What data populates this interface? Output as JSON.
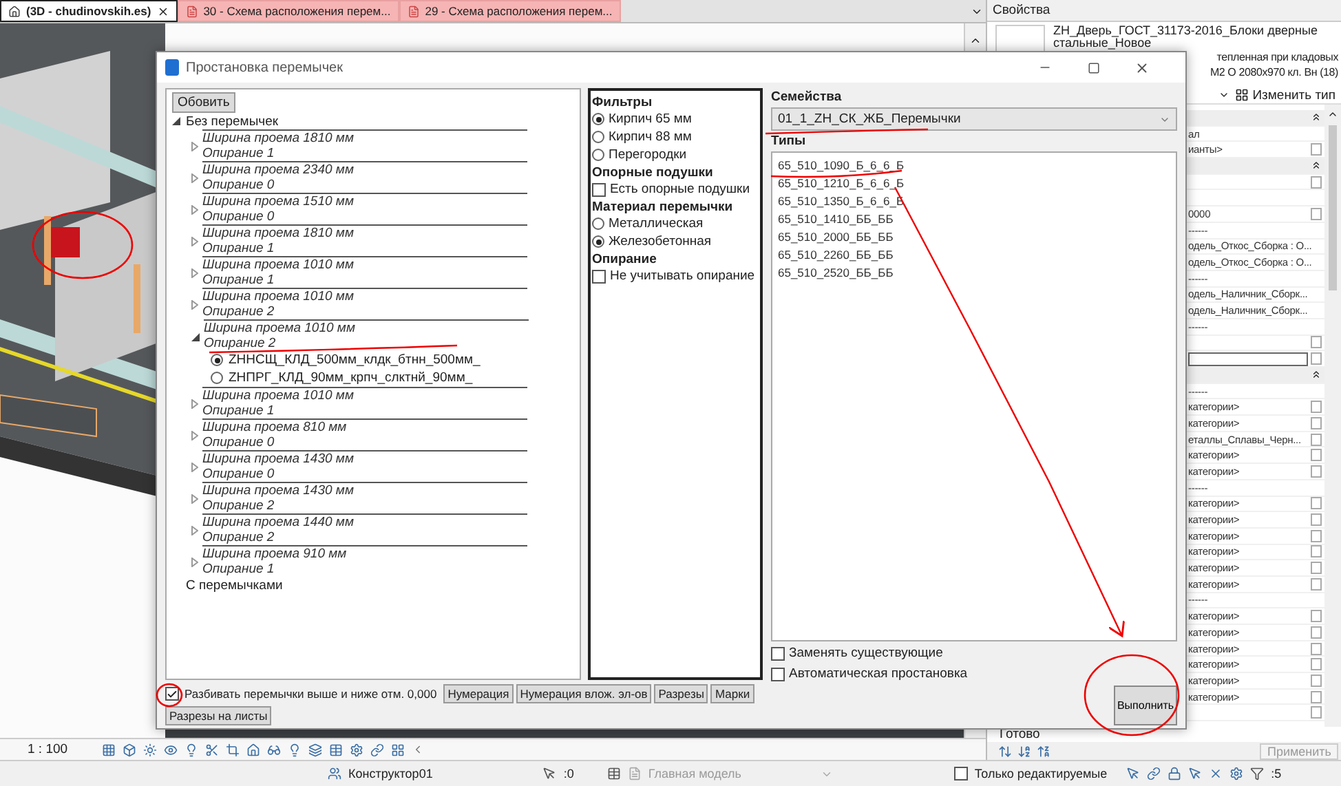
{
  "tabs": [
    {
      "label": "(3D - chudinovskih.es)",
      "selected": true,
      "kind": "model"
    },
    {
      "label": "30 - Схема расположения перем...",
      "selected": false,
      "kind": "sheet"
    },
    {
      "label": "29 - Схема расположения перем...",
      "selected": false,
      "kind": "sheet"
    }
  ],
  "dialog": {
    "title": "Простановка перемычек",
    "refresh_button": "Обовить",
    "tree": [
      {
        "label": "Без перемычек",
        "expanded": true,
        "children": [
          {
            "width": "Ширина проема 1810 мм",
            "support": "Опирание 1",
            "expanded": false
          },
          {
            "width": "Ширина проема 2340 мм",
            "support": "Опирание 0",
            "expanded": false
          },
          {
            "width": "Ширина проема 1510 мм",
            "support": "Опирание 0",
            "expanded": false
          },
          {
            "width": "Ширина проема 1810 мм",
            "support": "Опирание 1",
            "expanded": false
          },
          {
            "width": "Ширина проема 1010 мм",
            "support": "Опирание 1",
            "expanded": false
          },
          {
            "width": "Ширина проема 1010 мм",
            "support": "Опирание 2",
            "expanded": false
          },
          {
            "width": "Ширина проема 1010 мм",
            "support": "Опирание 2",
            "expanded": true,
            "children": [
              {
                "label": "ZHНСЩ_КЛД_500мм_клдк_бтнн_500мм_",
                "selected": true
              },
              {
                "label": "ZHПРГ_КЛД_90мм_крпч_слктнй_90мм_",
                "selected": false
              }
            ]
          },
          {
            "width": "Ширина проема 1010 мм",
            "support": "Опирание 1",
            "expanded": false
          },
          {
            "width": "Ширина проема 810 мм",
            "support": "Опирание 0",
            "expanded": false
          },
          {
            "width": "Ширина проема 1430 мм",
            "support": "Опирание 0",
            "expanded": false
          },
          {
            "width": "Ширина проема 1430 мм",
            "support": "Опирание 2",
            "expanded": false
          },
          {
            "width": "Ширина проема 1440 мм",
            "support": "Опирание 2",
            "expanded": false
          },
          {
            "width": "Ширина проема 910 мм",
            "support": "Опирание 1",
            "expanded": false
          }
        ]
      },
      {
        "label": "С перемычками"
      }
    ],
    "filters": [
      {
        "title": "Фильтры",
        "options": [
          {
            "kind": "radio",
            "label": "Кирпич 65 мм",
            "selected": true
          },
          {
            "kind": "radio",
            "label": "Кирпич 88 мм",
            "selected": false
          },
          {
            "kind": "radio",
            "label": "Перегородки",
            "selected": false
          }
        ]
      },
      {
        "title": "Опорные подушки",
        "options": [
          {
            "kind": "checkbox",
            "label": "Есть опорные подушки",
            "checked": false
          }
        ]
      },
      {
        "title": "Материал перемычки",
        "options": [
          {
            "kind": "radio",
            "label": "Металлическая",
            "selected": false
          },
          {
            "kind": "radio",
            "label": "Железобетонная",
            "selected": true
          }
        ]
      },
      {
        "title": "Опирание",
        "options": [
          {
            "kind": "checkbox",
            "label": "Не учитывать опирание",
            "checked": false
          }
        ]
      }
    ],
    "families_label": "Семейства",
    "family": "01_1_ZH_СК_ЖБ_Перемычки",
    "types_label": "Типы",
    "types": [
      "65_510_1090_Б_6_6_Б",
      "65_510_1210_Б_6_6_Б",
      "65_510_1350_Б_6_6_Б",
      "65_510_1410_ББ_ББ",
      "65_510_2000_ББ_ББ",
      "65_510_2260_ББ_ББ",
      "65_510_2520_ББ_ББ"
    ],
    "options": [
      {
        "label": "Заменять существующие",
        "checked": false
      },
      {
        "label": "Автоматическая простановка",
        "checked": false
      }
    ],
    "split_option": {
      "label": "Разбивать перемычки выше и ниже отм. 0,000",
      "checked": true
    },
    "buttons": [
      "Нумерация",
      "Нумерация влож. эл-ов",
      "Разрезы",
      "Марки",
      "Разрезы на листы"
    ],
    "run_button": "Выполнить"
  },
  "view_bar": {
    "scale": "1 : 100"
  },
  "properties": {
    "title": "Свойства",
    "type_name_lines": [
      "ZH_Дверь_ГОСТ_31173-2016_Блоки дверные",
      "стальные_Новое"
    ],
    "type_name_tail_lines": [
      "тепленная при кладовых",
      "М2 О 2080х970 кл. Вн (18)"
    ],
    "edit_type_button": "Изменить тип",
    "rows": [
      {
        "kind": "header"
      },
      {
        "kind": "value",
        "value": "ал"
      },
      {
        "kind": "value",
        "value": "ианты>",
        "checked": false
      },
      {
        "kind": "header"
      },
      {
        "kind": "value",
        "checked": false
      },
      {
        "kind": "value"
      },
      {
        "kind": "value",
        "value": "0000",
        "checked": false
      },
      {
        "kind": "value",
        "value": "------"
      },
      {
        "kind": "value",
        "value": "одель_Откос_Сборка : О..."
      },
      {
        "kind": "value",
        "value": "одель_Откос_Сборка : О..."
      },
      {
        "kind": "value",
        "value": "------"
      },
      {
        "kind": "value",
        "value": "одель_Наличник_Сборк..."
      },
      {
        "kind": "value",
        "value": "одель_Наличник_Сборк..."
      },
      {
        "kind": "value",
        "value": "------"
      },
      {
        "kind": "value",
        "checked": false
      },
      {
        "kind": "field",
        "checked": false
      },
      {
        "kind": "header"
      },
      {
        "kind": "value",
        "value": "------"
      },
      {
        "kind": "value",
        "value": "категории>",
        "checked": false
      },
      {
        "kind": "value",
        "value": "категории>",
        "checked": false
      },
      {
        "kind": "value",
        "value": "еталлы_Сплавы_Черн...",
        "checked": false
      },
      {
        "kind": "value",
        "value": "категории>",
        "checked": false
      },
      {
        "kind": "value",
        "value": "категории>",
        "checked": false
      },
      {
        "kind": "value",
        "value": "------"
      },
      {
        "kind": "value",
        "value": "категории>",
        "checked": false
      },
      {
        "kind": "value",
        "value": "категории>",
        "checked": false
      },
      {
        "kind": "value",
        "value": "категории>",
        "checked": false
      },
      {
        "kind": "value",
        "value": "категории>",
        "checked": false
      },
      {
        "kind": "value",
        "value": "категории>",
        "checked": false
      },
      {
        "kind": "value",
        "value": "категории>",
        "checked": false
      },
      {
        "kind": "value",
        "value": "------"
      },
      {
        "kind": "value",
        "value": "категории>",
        "checked": false
      },
      {
        "kind": "value",
        "value": "категории>",
        "checked": false
      },
      {
        "kind": "value",
        "value": "категории>",
        "checked": false
      },
      {
        "kind": "value",
        "value": "категории>",
        "checked": false
      },
      {
        "kind": "value",
        "value": "категории>",
        "checked": false
      },
      {
        "kind": "value",
        "value": "категории>",
        "checked": false
      },
      {
        "kind": "value",
        "checked": false
      }
    ],
    "status": "Готово",
    "apply_button": "Применить"
  },
  "status_bar": {
    "user": "Конструктор01",
    "worksets": ":0",
    "model": "Главная модель",
    "editable_only": {
      "label": "Только редактируемые",
      "checked": false
    },
    "filters": ":5"
  }
}
